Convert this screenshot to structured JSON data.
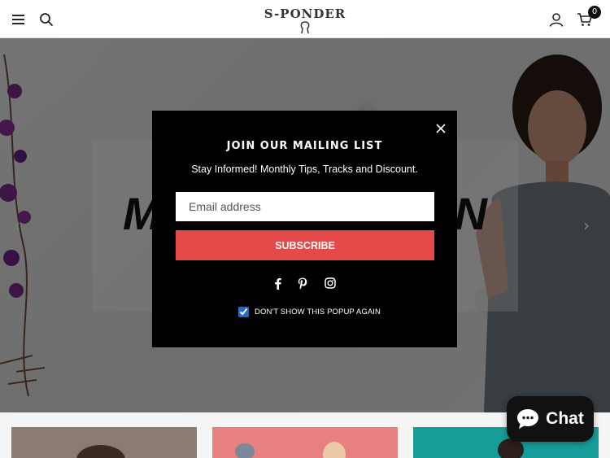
{
  "header": {
    "logo_text": "S-PONDER",
    "cart_count": "0",
    "icons": [
      "menu-icon",
      "search-icon",
      "account-icon",
      "cart-icon"
    ]
  },
  "hero": {
    "heading_left": "M",
    "heading_right": "N",
    "prev_arrow": "‹",
    "next_arrow": "›"
  },
  "popup": {
    "title": "JOIN OUR MAILING LIST",
    "subtitle": "Stay Informed! Monthly Tips, Tracks and Discount.",
    "email_placeholder": "Email address",
    "subscribe_label": "SUBSCRIBE",
    "social_icons": [
      "facebook-icon",
      "pinterest-icon",
      "instagram-icon"
    ],
    "dont_show_label": "DON'T SHOW THIS POPUP AGAIN",
    "dont_show_checked": true
  },
  "chat": {
    "label": "Chat"
  },
  "colors": {
    "subscribe": "#e54a4a",
    "popup_bg": "#000000",
    "checkbox": "#1e6ad6",
    "card_1": "#8a7c73",
    "card_2": "#e8807f",
    "card_3": "#179e9a"
  }
}
